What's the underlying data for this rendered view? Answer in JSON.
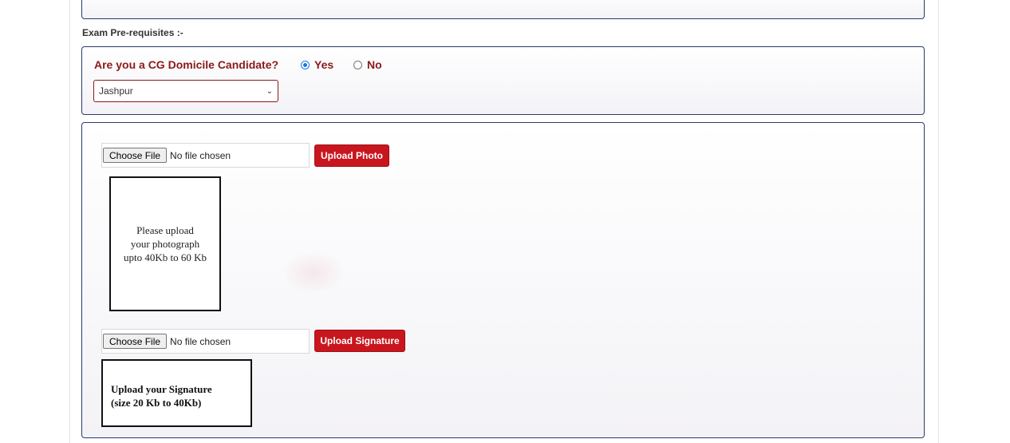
{
  "section_label": "Exam Pre-requisites :-",
  "domicile": {
    "question": "Are you a CG Domicile Candidate?",
    "options": [
      {
        "label": "Yes",
        "selected": true
      },
      {
        "label": "No",
        "selected": false
      }
    ],
    "district_selected": "Jashpur"
  },
  "photo_upload": {
    "choose_label": "Choose File",
    "file_status": "No file chosen",
    "button_label": "Upload Photo",
    "placeholder_lines": [
      "Please upload",
      "your photograph",
      "upto 40Kb to 60 Kb"
    ]
  },
  "signature_upload": {
    "choose_label": "Choose File",
    "file_status": "No file chosen",
    "button_label": "Upload Signature",
    "placeholder_lines": [
      "Upload your Signature",
      "(size 20 Kb to 40Kb)"
    ]
  },
  "colors": {
    "accent_red": "#c9161e",
    "label_maroon": "#8b1a1a",
    "panel_border": "#2d3a6b",
    "radio_blue": "#1a73e8"
  },
  "icons": {
    "select_chevron": "chevron-down-icon"
  }
}
